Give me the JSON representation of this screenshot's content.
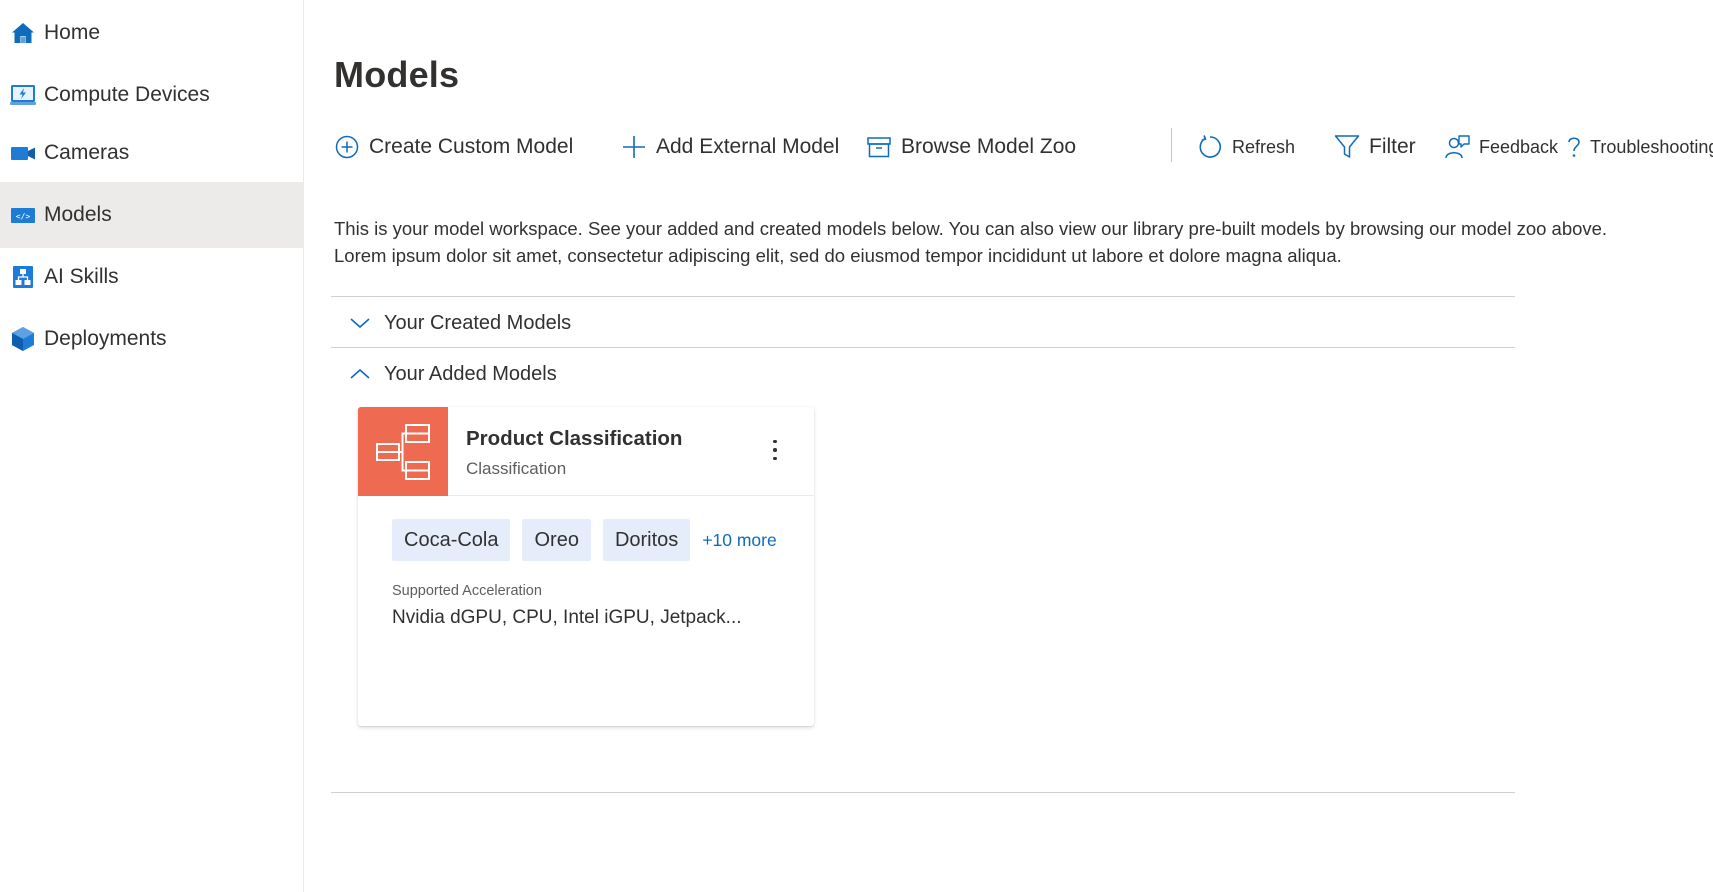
{
  "sidebar": {
    "items": [
      {
        "label": "Home",
        "icon": "home-icon"
      },
      {
        "label": "Compute Devices",
        "icon": "compute-device-icon"
      },
      {
        "label": "Cameras",
        "icon": "camera-icon"
      },
      {
        "label": "Models",
        "icon": "model-icon",
        "active": true
      },
      {
        "label": "AI Skills",
        "icon": "ai-skills-icon"
      },
      {
        "label": "Deployments",
        "icon": "deployment-icon"
      }
    ]
  },
  "page": {
    "title": "Models",
    "description_line1": "This is your model workspace. See your added and created models below. You can also view our library pre-built models by browsing our model zoo above.",
    "description_line2": "Lorem ipsum dolor sit amet, consectetur adipiscing elit, sed do eiusmod tempor incididunt ut labore et dolore magna aliqua."
  },
  "toolbar": {
    "create_custom_model": "Create Custom Model",
    "add_external_model": "Add External Model",
    "browse_model_zoo": "Browse Model Zoo",
    "refresh": "Refresh",
    "filter": "Filter",
    "feedback": "Feedback",
    "troubleshooting": "Troubleshooting"
  },
  "sections": {
    "created": {
      "label": "Your Created Models",
      "expanded": false
    },
    "added": {
      "label": "Your Added Models",
      "expanded": true
    }
  },
  "card": {
    "title": "Product Classification",
    "subtitle": "Classification",
    "tags": [
      "Coca-Cola",
      "Oreo",
      "Doritos"
    ],
    "more_tags": "+10 more",
    "acceleration_label": "Supported Acceleration",
    "acceleration_value": "Nvidia dGPU, CPU, Intel iGPU, Jetpack..."
  },
  "colors": {
    "accent": "#0f6cbd",
    "card_thumb": "#ee6a50",
    "tag_bg": "#e6edfa",
    "active_nav": "#edebe9"
  }
}
